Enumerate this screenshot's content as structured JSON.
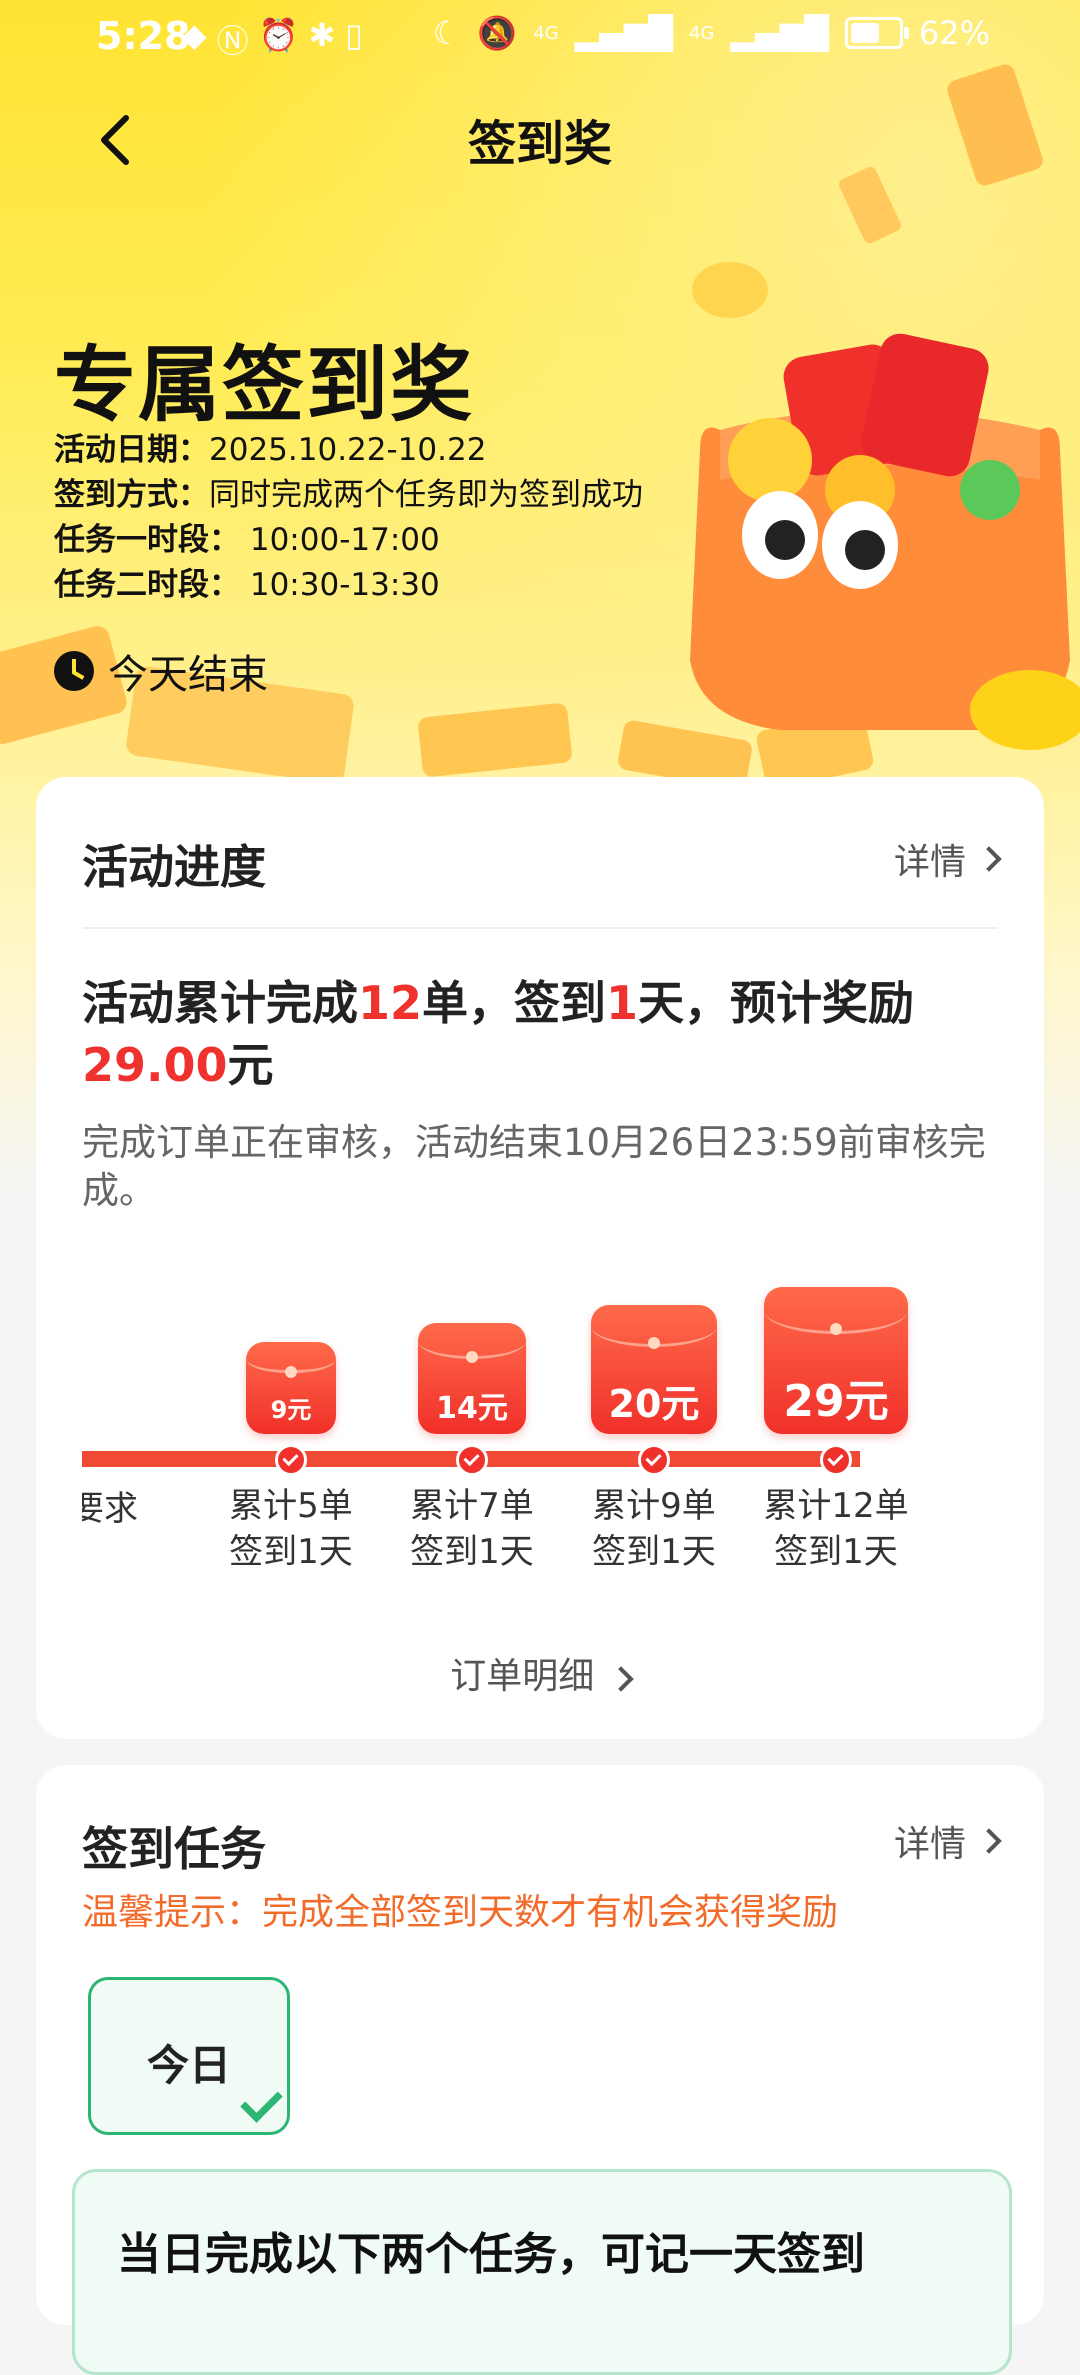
{
  "status_bar": {
    "time": "5:28",
    "battery": "62%",
    "signal_1": "4G",
    "signal_2": "4G"
  },
  "nav": {
    "title": "签到奖"
  },
  "hero": {
    "title": "专属签到奖",
    "rows": [
      {
        "label": "活动日期：",
        "value": "2025.10.22-10.22"
      },
      {
        "label": "签到方式：",
        "value": "同时完成两个任务即为签到成功"
      },
      {
        "label": "任务一时段：",
        "value": "10:00-17:00"
      },
      {
        "label": "任务二时段：",
        "value": "10:30-13:30"
      }
    ],
    "timer_text": "今天结束"
  },
  "progress_card": {
    "title": "活动进度",
    "detail_label": "详情",
    "summary": {
      "part1": "活动累计完成",
      "orders": "12",
      "part2": "单，签到",
      "days": "1",
      "part3": "天，预计奖励",
      "reward": "29.00",
      "unit": "元"
    },
    "note": "完成订单正在审核，活动结束10月26日23:59前审核完成。",
    "cut_label": "要求",
    "milestones": [
      {
        "amount": "9元",
        "line1": "累计5单",
        "line2": "签到1天",
        "completed": true
      },
      {
        "amount": "14元",
        "line1": "累计7单",
        "line2": "签到1天",
        "completed": true
      },
      {
        "amount": "20元",
        "line1": "累计9单",
        "line2": "签到1天",
        "completed": true
      },
      {
        "amount": "29元",
        "line1": "累计12单",
        "line2": "签到1天",
        "completed": true
      }
    ],
    "orders_link": "订单明细"
  },
  "tasks_card": {
    "title": "签到任务",
    "detail_label": "详情",
    "tip": "温馨提示：完成全部签到天数才有机会获得奖励",
    "today_tab": "今日",
    "task_box_text": "当日完成以下两个任务，可记一天签到"
  },
  "colors": {
    "accent_red": "#f0322f",
    "hero_yellow": "#ffe433",
    "success_green": "#2bb673",
    "tip_orange": "#f36b2a"
  }
}
